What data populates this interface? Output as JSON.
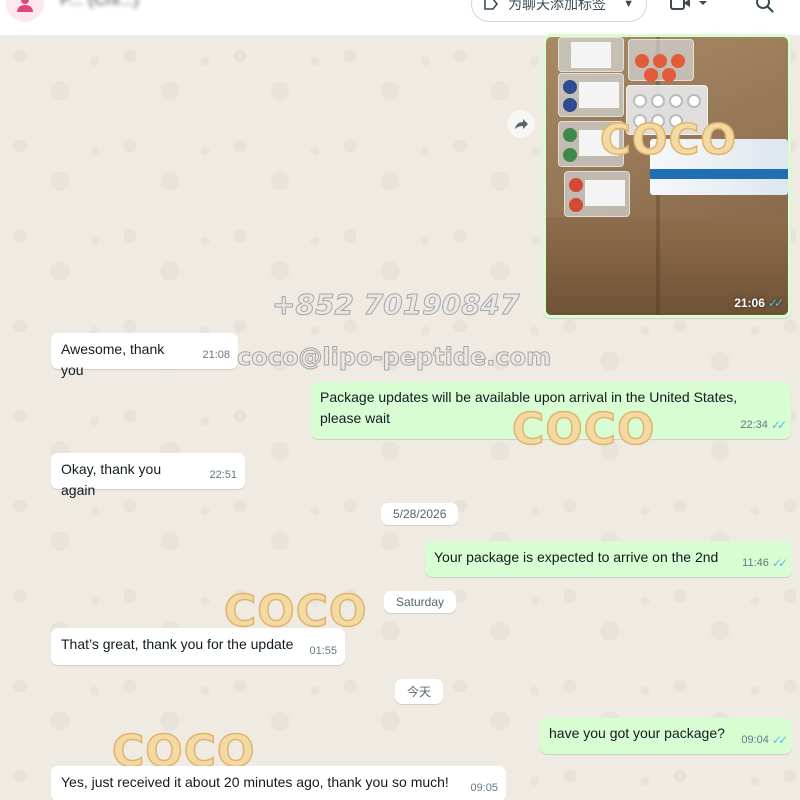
{
  "header": {
    "contact_name": "P... (Chi...)",
    "label_button": "为聊天添加标签",
    "icons": [
      "avatar-icon",
      "tag-icon",
      "chevron-down-icon",
      "video-call-icon",
      "search-icon"
    ]
  },
  "image_message": {
    "time": "21:06",
    "status": "read",
    "watermark": "COCO"
  },
  "messages": [
    {
      "direction": "in",
      "text": "Awesome, thank you",
      "time": "21:08"
    },
    {
      "direction": "out",
      "text": "Package updates will be available upon arrival in the United States, please wait",
      "time": "22:34",
      "status": "read"
    },
    {
      "direction": "in",
      "text": "Okay, thank you again",
      "time": "22:51"
    },
    {
      "direction": "out",
      "text": "Your package is expected to arrive on the 2nd",
      "time": "11:46",
      "status": "read"
    },
    {
      "direction": "in",
      "text": "That’s great, thank you for the update",
      "time": "01:55"
    },
    {
      "direction": "out",
      "text": "have you got your package?",
      "time": "09:04",
      "status": "read"
    },
    {
      "direction": "in",
      "text": "Yes, just received it about 20 minutes ago, thank you so much!",
      "time": "09:05"
    }
  ],
  "date_chips": [
    "5/28/2026",
    "Saturday",
    "今天"
  ],
  "watermarks": {
    "phone": "+852 70190847",
    "email": "coco@lipo-peptide.com",
    "brand": "COCO"
  },
  "colors": {
    "chat_background": "#efeae2",
    "incoming_bubble": "#ffffff",
    "outgoing_bubble": "#d9fdd3",
    "read_ticks": "#53bdeb",
    "watermark_fill": "#f3d9a4"
  }
}
